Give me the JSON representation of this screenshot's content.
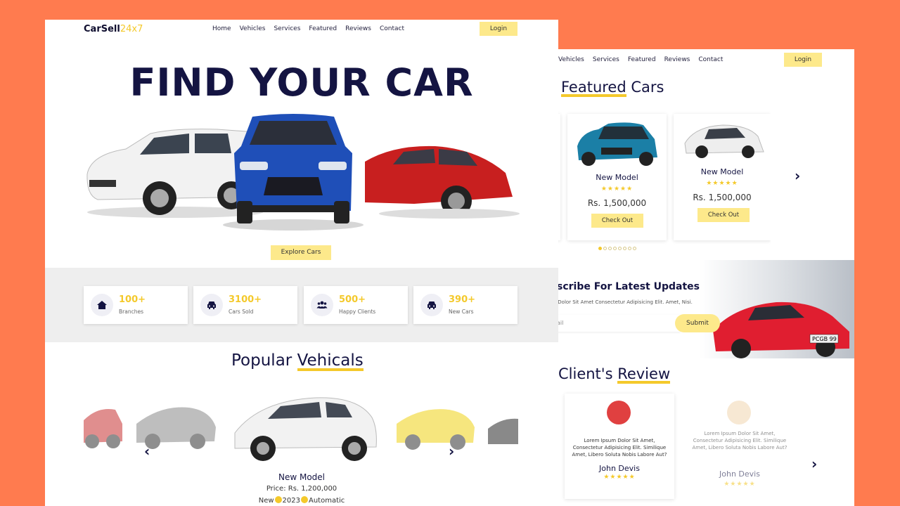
{
  "colors": {
    "background": "#ff7b4f",
    "accent": "#f4c92b",
    "button": "#fde98b",
    "navy": "#141442"
  },
  "left": {
    "logo": {
      "main": "CarSell",
      "accent": "24x7"
    },
    "nav": [
      "Home",
      "Vehicles",
      "Services",
      "Featured",
      "Reviews",
      "Contact"
    ],
    "login": "Login",
    "hero_title": "FIND YOUR CAR",
    "explore": "Explore Cars",
    "stats": [
      {
        "icon": "home-icon",
        "value": "100+",
        "label": "Branches"
      },
      {
        "icon": "car-icon",
        "value": "3100+",
        "label": "Cars Sold"
      },
      {
        "icon": "users-icon",
        "value": "500+",
        "label": "Happy Clients"
      },
      {
        "icon": "car-icon",
        "value": "390+",
        "label": "New Cars"
      }
    ],
    "popular": {
      "title_a": "Popular ",
      "title_b": "Vehicals",
      "model": "New Model",
      "price": "Price: Rs. 1,200,000",
      "meta_a": "New",
      "meta_b": "2023",
      "meta_c": "Automatic"
    }
  },
  "right": {
    "nav": [
      "Vehicles",
      "Services",
      "Featured",
      "Reviews",
      "Contact"
    ],
    "login": "Login",
    "featured": {
      "title_a": "Featured",
      "title_b": " Cars",
      "cards": [
        {
          "model": "New Model",
          "stars": "★★★★★",
          "price": "Rs. 1,500,000",
          "button": "Check Out"
        },
        {
          "model": "New Model",
          "stars": "★★★★★",
          "price": "Rs. 1,500,000",
          "button": "Check Out"
        }
      ],
      "dots_total": 8,
      "dots_active": 0
    },
    "subscribe": {
      "title": "bscribe For Latest Updates",
      "text": "m, Dolor Sit Amet Consectetur Adipisicing Elit. Amet, Nisi.",
      "placeholder": "ail",
      "button": "Submit",
      "plate": "PCGB 99"
    },
    "reviews": {
      "title_a": "Client's ",
      "title_b": "Review",
      "cards": [
        {
          "text": "Lorem Ipsum Dolor Sit Amet, Consectetur Adipisicing Elit. Similique Amet, Libero Soluta Nobis Labore Aut?",
          "name": "John Devis",
          "stars": "★★★★★"
        },
        {
          "text": "Lorem Ipsum Dolor Sit Amet, Consectetur Adipisicing Elit. Similique Amet, Libero Soluta Nobis Labore Aut?",
          "name": "John Devis",
          "stars": "★★★★★"
        }
      ]
    }
  }
}
